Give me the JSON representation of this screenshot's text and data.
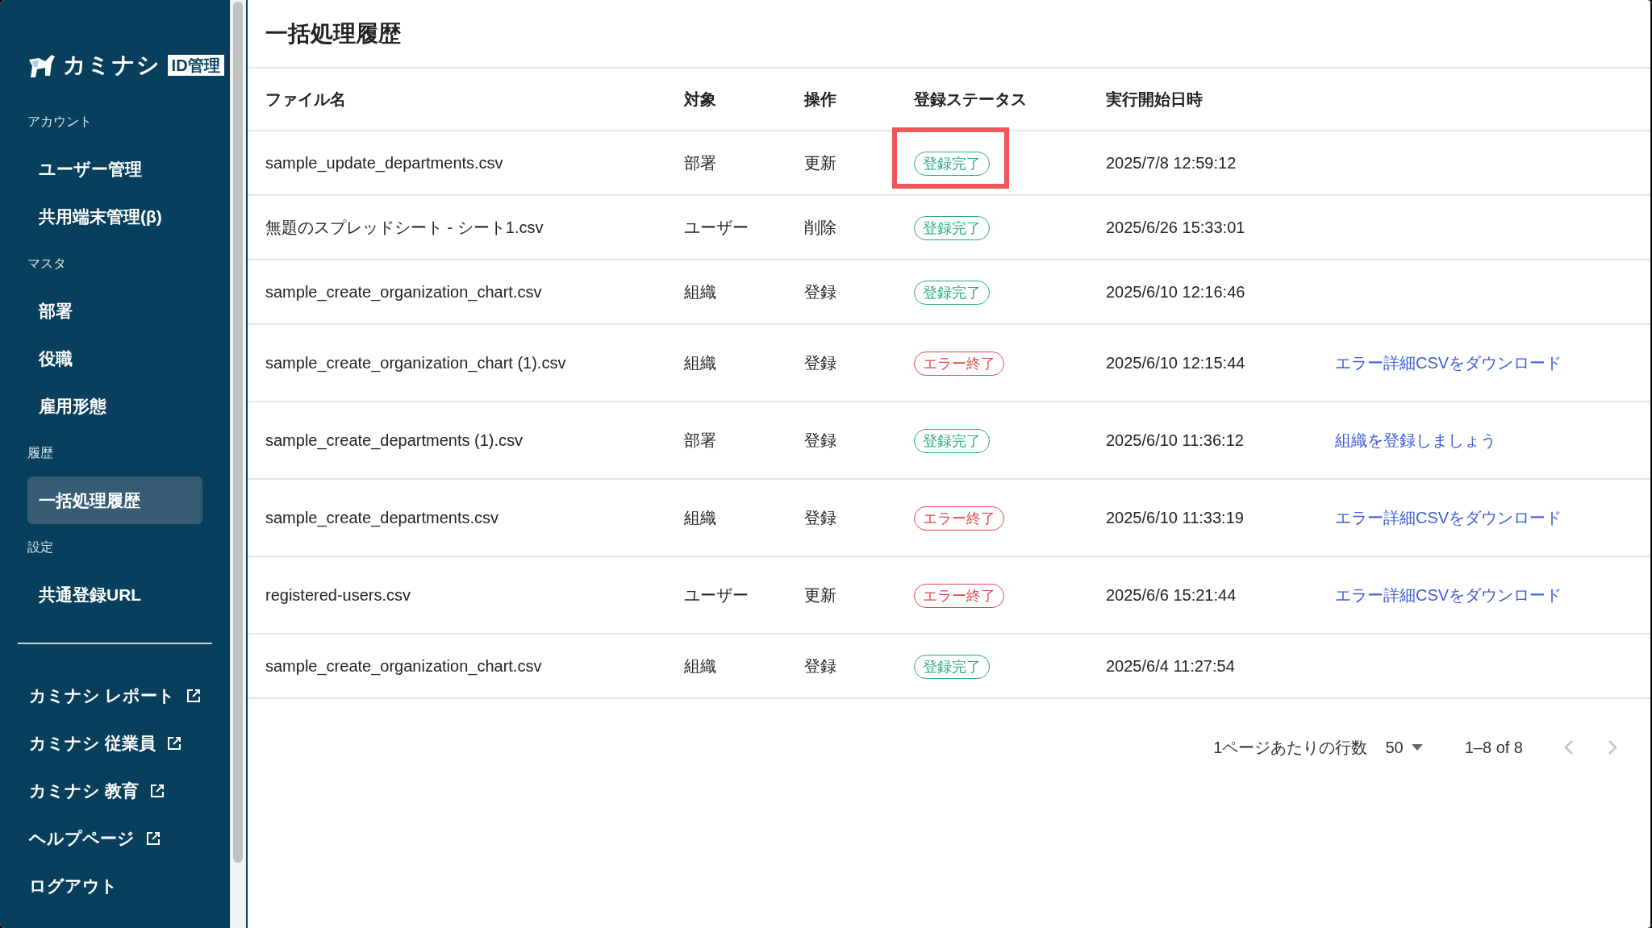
{
  "sidebar": {
    "logo": {
      "name": "カミナシ",
      "badge": "ID管理"
    },
    "sections": [
      {
        "label": "アカウント",
        "items": [
          {
            "label": "ユーザー管理",
            "selected": false
          },
          {
            "label": "共用端末管理(β)",
            "selected": false
          }
        ]
      },
      {
        "label": "マスタ",
        "items": [
          {
            "label": "部署",
            "selected": false
          },
          {
            "label": "役職",
            "selected": false
          },
          {
            "label": "雇用形態",
            "selected": false
          }
        ]
      },
      {
        "label": "履歴",
        "items": [
          {
            "label": "一括処理履歴",
            "selected": true
          }
        ]
      },
      {
        "label": "設定",
        "items": [
          {
            "label": "共通登録URL",
            "selected": false
          }
        ]
      }
    ],
    "links": [
      {
        "label": "カミナシ レポート",
        "kind": "external"
      },
      {
        "label": "カミナシ 従業員",
        "kind": "external"
      },
      {
        "label": "カミナシ 教育",
        "kind": "external"
      },
      {
        "label": "ヘルプページ",
        "kind": "external"
      },
      {
        "label": "ログアウト",
        "kind": "plain"
      }
    ]
  },
  "page": {
    "title": "一括処理履歴"
  },
  "table": {
    "columns": [
      "ファイル名",
      "対象",
      "操作",
      "登録ステータス",
      "実行開始日時"
    ],
    "rows": [
      {
        "file": "sample_update_departments.csv",
        "target": "部署",
        "operation": "更新",
        "status": {
          "label": "登録完了",
          "kind": "success",
          "highlighted": true
        },
        "started": "2025/7/8 12:59:12"
      },
      {
        "file": "無題のスプレッドシート - シート1.csv",
        "target": "ユーザー",
        "operation": "削除",
        "status": {
          "label": "登録完了",
          "kind": "success",
          "highlighted": false
        },
        "started": "2025/6/26 15:33:01"
      },
      {
        "file": "sample_create_organization_chart.csv",
        "target": "組織",
        "operation": "登録",
        "status": {
          "label": "登録完了",
          "kind": "success",
          "highlighted": false
        },
        "started": "2025/6/10 12:16:46"
      },
      {
        "file": "sample_create_organization_chart (1).csv",
        "target": "組織",
        "operation": "登録",
        "status": {
          "label": "エラー終了",
          "kind": "error",
          "highlighted": false
        },
        "started": "2025/6/10 12:15:44",
        "action": "エラー詳細CSVをダウンロード"
      },
      {
        "file": "sample_create_departments (1).csv",
        "target": "部署",
        "operation": "登録",
        "status": {
          "label": "登録完了",
          "kind": "success",
          "highlighted": false
        },
        "started": "2025/6/10 11:36:12",
        "action": "組織を登録しましょう"
      },
      {
        "file": "sample_create_departments.csv",
        "target": "組織",
        "operation": "登録",
        "status": {
          "label": "エラー終了",
          "kind": "error",
          "highlighted": false
        },
        "started": "2025/6/10 11:33:19",
        "action": "エラー詳細CSVをダウンロード"
      },
      {
        "file": "registered-users.csv",
        "target": "ユーザー",
        "operation": "更新",
        "status": {
          "label": "エラー終了",
          "kind": "error",
          "highlighted": false
        },
        "started": "2025/6/6 15:21:44",
        "action": "エラー詳細CSVをダウンロード"
      },
      {
        "file": "sample_create_organization_chart.csv",
        "target": "組織",
        "operation": "登録",
        "status": {
          "label": "登録完了",
          "kind": "success",
          "highlighted": false
        },
        "started": "2025/6/4 11:27:54"
      }
    ]
  },
  "pagination": {
    "rows_per_page_label": "1ページあたりの行数",
    "rows_per_page": "50",
    "range": "1–8 of 8",
    "prev_disabled": true,
    "next_disabled": true
  }
}
